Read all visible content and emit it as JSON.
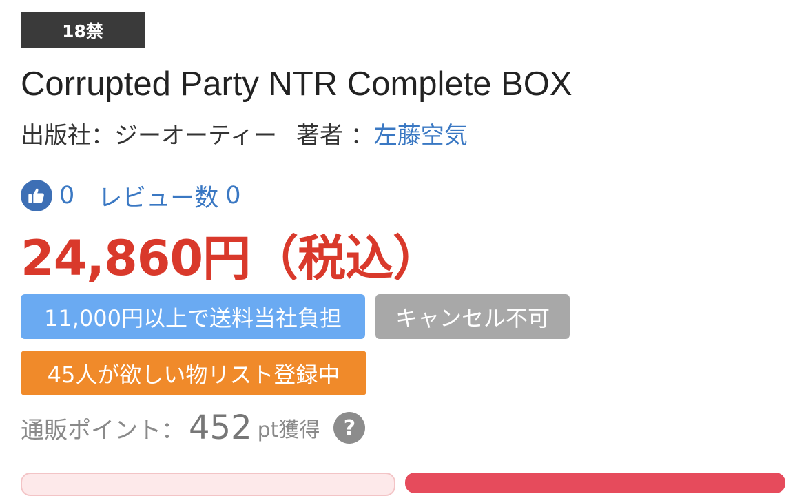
{
  "age_badge": "18禁",
  "title": "Corrupted Party NTR Complete BOX",
  "meta": {
    "publisher_label": "出版社：",
    "publisher": "ジーオーティー",
    "author_label": "著者 ：",
    "author": "左藤空気"
  },
  "reviews": {
    "like_icon": "thumbs-up-icon",
    "like_count": "0",
    "review_label": "レビュー数",
    "review_count": "0"
  },
  "price": "24,860円（税込）",
  "tags": {
    "shipping": "11,000円以上で送料当社負担",
    "cancel": "キャンセル不可",
    "wishlist": "45人が欲しい物リスト登録中"
  },
  "points": {
    "label": "通販ポイント：",
    "value": "452",
    "suffix": "pt獲得",
    "help_icon": "?"
  },
  "colors": {
    "price": "#d9392b",
    "link": "#3a78c3",
    "shipping_tag": "#6aaaf2",
    "cancel_tag": "#a8a8a8",
    "wishlist_tag": "#f08a2a",
    "age_badge": "#3a3a3a"
  }
}
